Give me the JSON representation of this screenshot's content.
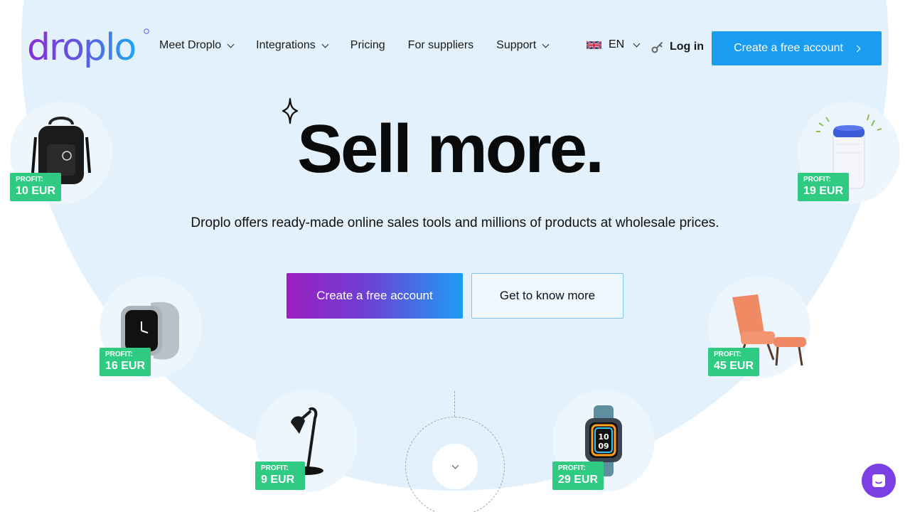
{
  "header": {
    "logo_text": "droplo",
    "nav": [
      {
        "label": "Meet Droplo",
        "dropdown": true
      },
      {
        "label": "Integrations",
        "dropdown": true
      },
      {
        "label": "Pricing",
        "dropdown": false
      },
      {
        "label": "For suppliers",
        "dropdown": false
      },
      {
        "label": "Support",
        "dropdown": true
      }
    ],
    "language": "EN",
    "login_label": "Log in",
    "cta_label": "Create a free account"
  },
  "hero": {
    "title": "Sell more.",
    "subtitle": "Droplo offers ready-made online sales tools and millions of products at wholesale prices.",
    "primary_button": "Create a free account",
    "secondary_button": "Get to know more"
  },
  "products": [
    {
      "name": "backpack-icon",
      "profit_label": "PROFIT:",
      "profit_value": "10 EUR"
    },
    {
      "name": "air-purifier-icon",
      "profit_label": "PROFIT:",
      "profit_value": "19 EUR"
    },
    {
      "name": "smartwatch-grey-icon",
      "profit_label": "PROFIT:",
      "profit_value": "16 EUR"
    },
    {
      "name": "armchair-icon",
      "profit_label": "PROFIT:",
      "profit_value": "45 EUR"
    },
    {
      "name": "desk-lamp-icon",
      "profit_label": "PROFIT:",
      "profit_value": "9 EUR"
    },
    {
      "name": "smartwatch-blue-icon",
      "profit_label": "PROFIT:",
      "profit_value": "29 EUR"
    }
  ],
  "colors": {
    "accent_blue": "#1a9cf0",
    "gradient_start": "#9b1fc0",
    "profit_green": "#2fcb82",
    "hero_bg": "#e3f1fc",
    "chat_purple": "#7b3fe4"
  }
}
